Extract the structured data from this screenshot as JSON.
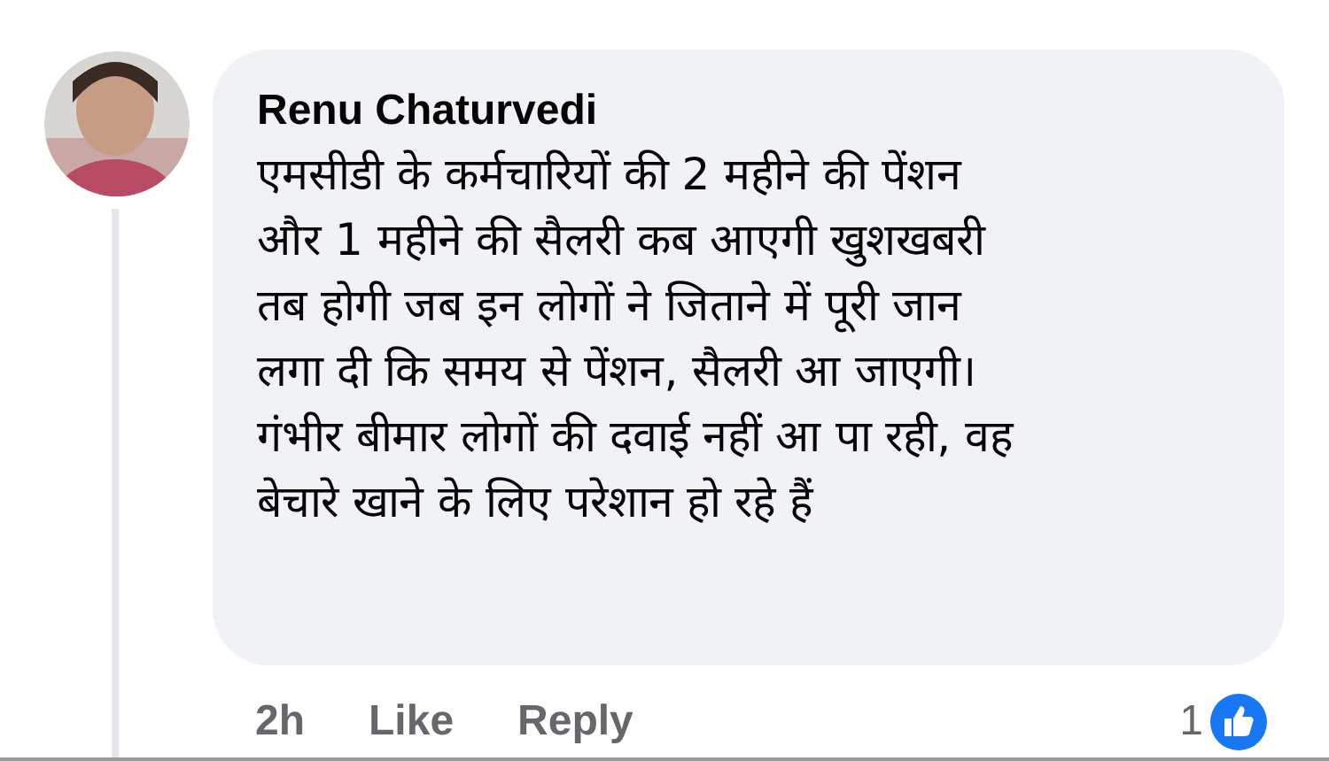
{
  "comment": {
    "author": "Renu Chaturvedi",
    "text": "एमसीडी के कर्मचारियों की 2 महीने की पेंशन\nऔर 1 महीने की सैलरी कब आएगी खुशखबरी\nतब होगी जब इन लोगों ने जिताने में पूरी जान\nलगा दी कि समय से पेंशन, सैलरी आ जाएगी।\nगंभीर बीमार लोगों की दवाई नहीं आ पा रही, वह\nबेचारे खाने के लिए परेशान हो रहे हैं",
    "time": "2h",
    "actions": [
      "Like",
      "Reply"
    ],
    "reaction_count": "1"
  }
}
